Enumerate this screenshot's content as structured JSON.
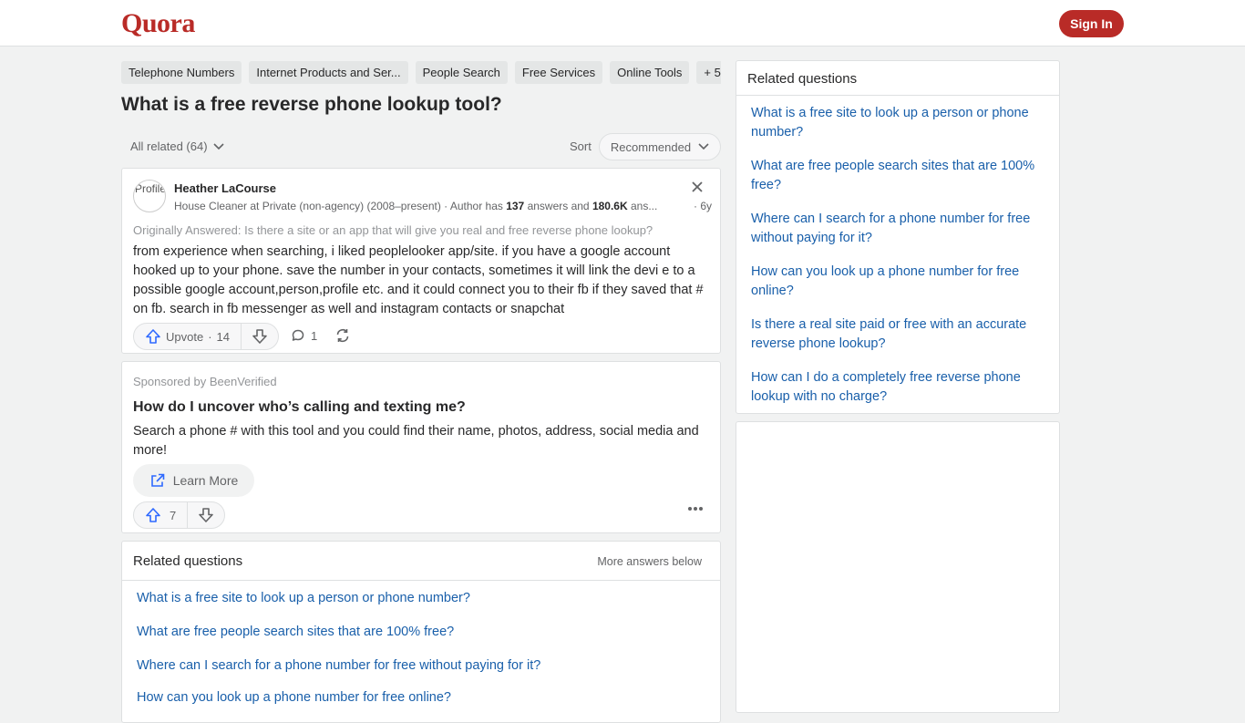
{
  "header": {
    "logo": "Quora",
    "signin_label": "Sign In"
  },
  "topics": [
    "Telephone Numbers",
    "Internet Products and Ser...",
    "People Search",
    "Free Services",
    "Online Tools",
    "+ 5"
  ],
  "question": {
    "title": "What is a free reverse phone lookup tool?"
  },
  "filters": {
    "all_related": "All related (64)",
    "sort_label": "Sort",
    "sort_value": "Recommended"
  },
  "answer": {
    "avatar_alt": "Profile",
    "author": "Heather LaCourse",
    "credential": "House Cleaner at Private (non-agency) (2008–present) · Author has ",
    "answers_count": "137",
    "answers_and": " answers and ",
    "views": "180.6K",
    "views_suffix": " ans...",
    "age": " · 6y",
    "originally_answered": "Originally Answered: Is there a site or an app that will give you real and free reverse phone lookup?",
    "body": "from experience when searching, i liked peoplelooker app/site. if you have a google account hooked up to your phone. save the number in your contacts, sometimes it will link the devi e to a possible google account,person,profile etc. and it could connect you to their fb if they saved that # on fb. search in fb messenger as well and instagram contacts or snapchat",
    "upvote_label": "Upvote",
    "upvote_count": "14",
    "comment_count": "1"
  },
  "sponsored": {
    "label": "Sponsored by BeenVerified",
    "title": "How do I uncover who’s calling and texting me?",
    "body": "Search a phone # with this tool and you could find their name, photos, address, social media and more!",
    "cta": "Learn More",
    "upvote_count": "7"
  },
  "related_main": {
    "title": "Related questions",
    "more": "More answers below",
    "items": [
      "What is a free site to look up a person or phone number?",
      "What are free people search sites that are 100% free?",
      "Where can I search for a phone number for free without paying for it?",
      "How can you look up a phone number for free online?"
    ]
  },
  "related_side": {
    "title": "Related questions",
    "items": [
      "What is a free site to look up a person or phone number?",
      "What are free people search sites that are 100% free?",
      "Where can I search for a phone number for free without paying for it?",
      "How can you look up a phone number for free online?",
      "Is there a real site paid or free with an accurate reverse phone lookup?",
      "How can I do a completely free reverse phone lookup with no charge?"
    ]
  },
  "colors": {
    "brand": "#b92b27",
    "link": "#195faa",
    "upvote": "#2e69ff"
  }
}
